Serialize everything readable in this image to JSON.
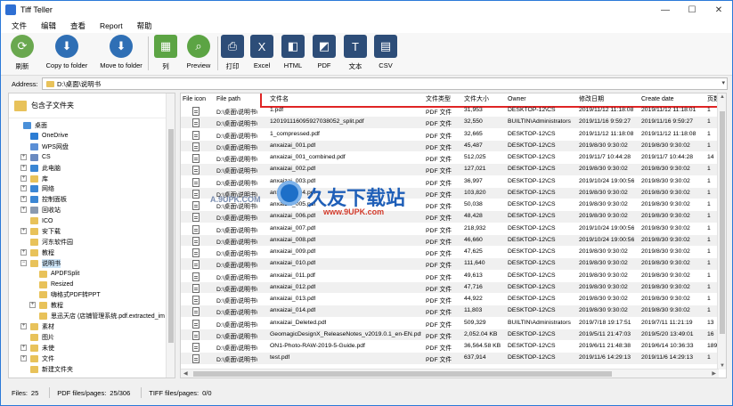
{
  "window": {
    "title": "Tiff Teller",
    "controls": [
      "—",
      "☐",
      "✕"
    ]
  },
  "menu": [
    "文件",
    "编辑",
    "查看",
    "Report",
    "帮助"
  ],
  "toolbar": [
    {
      "label": "刷新",
      "icon": "refresh-icon",
      "color": "#6aa84f"
    },
    {
      "label": "Copy to folder",
      "icon": "copy-to-folder-icon",
      "color": "#2f6fb5"
    },
    {
      "label": "Move to folder",
      "icon": "move-to-folder-icon",
      "color": "#2f6fb5"
    },
    {
      "label": "列",
      "icon": "columns-icon",
      "color": "#5ca444"
    },
    {
      "label": "Preview",
      "icon": "preview-icon",
      "color": "#5ca444"
    },
    {
      "label": "打印",
      "icon": "print-icon",
      "color": "#2d4d78"
    },
    {
      "label": "Excel",
      "icon": "excel-icon",
      "color": "#2d4d78"
    },
    {
      "label": "HTML",
      "icon": "html-icon",
      "color": "#2d4d78"
    },
    {
      "label": "PDF",
      "icon": "pdf-icon",
      "color": "#2d4d78"
    },
    {
      "label": "文本",
      "icon": "text-icon",
      "color": "#2d4d78"
    },
    {
      "label": "CSV",
      "icon": "csv-icon",
      "color": "#2d4d78"
    }
  ],
  "address": {
    "label": "Address:",
    "value": "D:\\桌面\\说明书"
  },
  "sidebar": {
    "header": "包含子文件夹",
    "items": [
      {
        "label": "桌面",
        "indent": 0,
        "expand": "",
        "color": "#4a90d9"
      },
      {
        "label": "OneDrive",
        "indent": 1,
        "expand": "",
        "color": "#2b7cd3"
      },
      {
        "label": "WPS网盘",
        "indent": 1,
        "expand": "",
        "color": "#5b8fd6"
      },
      {
        "label": "CS",
        "indent": 1,
        "expand": "+",
        "color": "#6a8ac0"
      },
      {
        "label": "此电脑",
        "indent": 1,
        "expand": "+",
        "color": "#3a86d4"
      },
      {
        "label": "库",
        "indent": 1,
        "expand": "+",
        "color": "#e8c25a"
      },
      {
        "label": "网络",
        "indent": 1,
        "expand": "+",
        "color": "#3a86d4"
      },
      {
        "label": "控制面板",
        "indent": 1,
        "expand": "+",
        "color": "#3a86d4"
      },
      {
        "label": "回收站",
        "indent": 1,
        "expand": "+",
        "color": "#8a9ab0"
      },
      {
        "label": "ICO",
        "indent": 1,
        "expand": "",
        "color": "#e8c25a"
      },
      {
        "label": "安下载",
        "indent": 1,
        "expand": "+",
        "color": "#e8c25a"
      },
      {
        "label": "河东软件园",
        "indent": 1,
        "expand": "",
        "color": "#e8c25a"
      },
      {
        "label": "教程",
        "indent": 1,
        "expand": "+",
        "color": "#e8c25a"
      },
      {
        "label": "说明书",
        "indent": 1,
        "expand": "−",
        "color": "#e8c25a",
        "selected": true
      },
      {
        "label": "APDFSplit",
        "indent": 2,
        "expand": "",
        "color": "#e8c25a"
      },
      {
        "label": "Resized",
        "indent": 2,
        "expand": "",
        "color": "#e8c25a"
      },
      {
        "label": "嗨格式PDF转PPT",
        "indent": 2,
        "expand": "",
        "color": "#e8c25a"
      },
      {
        "label": "教程",
        "indent": 2,
        "expand": "+",
        "color": "#e8c25a"
      },
      {
        "label": "思迅天店 (店铺管理系统.pdf.extracted_im",
        "indent": 2,
        "expand": "",
        "color": "#e8c25a"
      },
      {
        "label": "素材",
        "indent": 1,
        "expand": "+",
        "color": "#e8c25a"
      },
      {
        "label": "图片",
        "indent": 1,
        "expand": "",
        "color": "#e8c25a"
      },
      {
        "label": "未使",
        "indent": 1,
        "expand": "+",
        "color": "#e8c25a"
      },
      {
        "label": "文件",
        "indent": 1,
        "expand": "+",
        "color": "#e8c25a"
      },
      {
        "label": "新建文件夹",
        "indent": 1,
        "expand": "",
        "color": "#e8c25a"
      }
    ]
  },
  "table": {
    "headers": [
      "File icon",
      "File path",
      "文件名",
      "文件类型",
      "文件大小",
      "Owner",
      "修改日期",
      "Create date",
      "页数"
    ],
    "rows": [
      [
        "D:\\桌面\\说明书\\",
        "1.pdf",
        "PDF 文件",
        "31,953",
        "DESKTOP-12\\CS",
        "2019/11/12 11:18:08",
        "2019/11/12 11:18:01",
        "1"
      ],
      [
        "D:\\桌面\\说明书\\",
        "120191116095927038052_split.pdf",
        "PDF 文件",
        "32,550",
        "BUILTIN\\Administrators",
        "2019/11/16 9:59:27",
        "2019/11/16 9:59:27",
        "1"
      ],
      [
        "D:\\桌面\\说明书\\",
        "1_compressed.pdf",
        "PDF 文件",
        "32,665",
        "DESKTOP-12\\CS",
        "2019/11/12 11:18:08",
        "2019/11/12 11:18:08",
        "1"
      ],
      [
        "D:\\桌面\\说明书\\",
        "anxaizai_001.pdf",
        "PDF 文件",
        "45,487",
        "DESKTOP-12\\CS",
        "2019/8/30 9:30:02",
        "2019/8/30 9:30:02",
        "1"
      ],
      [
        "D:\\桌面\\说明书\\",
        "anxaizai_001_combined.pdf",
        "PDF 文件",
        "512,025",
        "DESKTOP-12\\CS",
        "2019/11/7 10:44:28",
        "2019/11/7 10:44:28",
        "14"
      ],
      [
        "D:\\桌面\\说明书\\",
        "anxaizai_002.pdf",
        "PDF 文件",
        "127,021",
        "DESKTOP-12\\CS",
        "2019/8/30 9:30:02",
        "2019/8/30 9:30:02",
        "1"
      ],
      [
        "D:\\桌面\\说明书\\",
        "anxaizai_003.pdf",
        "PDF 文件",
        "36,997",
        "DESKTOP-12\\CS",
        "2019/10/24 19:00:56",
        "2019/8/30 9:30:02",
        "1"
      ],
      [
        "D:\\桌面\\说明书\\",
        "anxaizai_004.pdf",
        "PDF 文件",
        "103,820",
        "DESKTOP-12\\CS",
        "2019/8/30 9:30:02",
        "2019/8/30 9:30:02",
        "1"
      ],
      [
        "D:\\桌面\\说明书\\",
        "anxaizai_005.pdf",
        "PDF 文件",
        "50,038",
        "DESKTOP-12\\CS",
        "2019/8/30 9:30:02",
        "2019/8/30 9:30:02",
        "1"
      ],
      [
        "D:\\桌面\\说明书\\",
        "anxaizai_006.pdf",
        "PDF 文件",
        "48,428",
        "DESKTOP-12\\CS",
        "2019/8/30 9:30:02",
        "2019/8/30 9:30:02",
        "1"
      ],
      [
        "D:\\桌面\\说明书\\",
        "anxaizai_007.pdf",
        "PDF 文件",
        "218,932",
        "DESKTOP-12\\CS",
        "2019/10/24 19:00:56",
        "2019/8/30 9:30:02",
        "1"
      ],
      [
        "D:\\桌面\\说明书\\",
        "anxaizai_008.pdf",
        "PDF 文件",
        "46,660",
        "DESKTOP-12\\CS",
        "2019/10/24 19:00:56",
        "2019/8/30 9:30:02",
        "1"
      ],
      [
        "D:\\桌面\\说明书\\",
        "anxaizai_009.pdf",
        "PDF 文件",
        "47,625",
        "DESKTOP-12\\CS",
        "2019/8/30 9:30:02",
        "2019/8/30 9:30:02",
        "1"
      ],
      [
        "D:\\桌面\\说明书\\",
        "anxaizai_010.pdf",
        "PDF 文件",
        "111,640",
        "DESKTOP-12\\CS",
        "2019/8/30 9:30:02",
        "2019/8/30 9:30:02",
        "1"
      ],
      [
        "D:\\桌面\\说明书\\",
        "anxaizai_011.pdf",
        "PDF 文件",
        "49,613",
        "DESKTOP-12\\CS",
        "2019/8/30 9:30:02",
        "2019/8/30 9:30:02",
        "1"
      ],
      [
        "D:\\桌面\\说明书\\",
        "anxaizai_012.pdf",
        "PDF 文件",
        "47,716",
        "DESKTOP-12\\CS",
        "2019/8/30 9:30:02",
        "2019/8/30 9:30:02",
        "1"
      ],
      [
        "D:\\桌面\\说明书\\",
        "anxaizai_013.pdf",
        "PDF 文件",
        "44,922",
        "DESKTOP-12\\CS",
        "2019/8/30 9:30:02",
        "2019/8/30 9:30:02",
        "1"
      ],
      [
        "D:\\桌面\\说明书\\",
        "anxaizai_014.pdf",
        "PDF 文件",
        "11,803",
        "DESKTOP-12\\CS",
        "2019/8/30 9:30:02",
        "2019/8/30 9:30:02",
        "1"
      ],
      [
        "D:\\桌面\\说明书\\",
        "anxaizai_Deleted.pdf",
        "PDF 文件",
        "509,329",
        "BUILTIN\\Administrators",
        "2019/7/18 19:17:51",
        "2019/7/11 11:21:19",
        "13"
      ],
      [
        "D:\\桌面\\说明书\\",
        "GeomagicDesignX_ReleaseNotes_v2019.0.1_en-EN.pdf",
        "PDF 文件",
        "2,052.04 KB",
        "DESKTOP-12\\CS",
        "2019/5/11 21:47:03",
        "2019/5/20 13:49:01",
        "16"
      ],
      [
        "D:\\桌面\\说明书\\",
        "ON1-Photo-RAW-2019-5-Guide.pdf",
        "PDF 文件",
        "36,564.58 KB",
        "DESKTOP-12\\CS",
        "2019/6/11 21:48:38",
        "2019/6/14 10:36:33",
        "189"
      ],
      [
        "D:\\桌面\\说明书\\",
        "test.pdf",
        "PDF 文件",
        "637,914",
        "DESKTOP-12\\CS",
        "2019/11/6 14:29:13",
        "2019/11/6 14:29:13",
        "1"
      ]
    ]
  },
  "watermark": {
    "text": "久友下载站",
    "url": "www.9UPK.com",
    "left_text": "A.9UPK.COM"
  },
  "status": {
    "files_label": "Files:",
    "files_value": "25",
    "pdf_label": "PDF files/pages:",
    "pdf_value": "25/306",
    "tiff_label": "TIFF files/pages:",
    "tiff_value": "0/0"
  }
}
